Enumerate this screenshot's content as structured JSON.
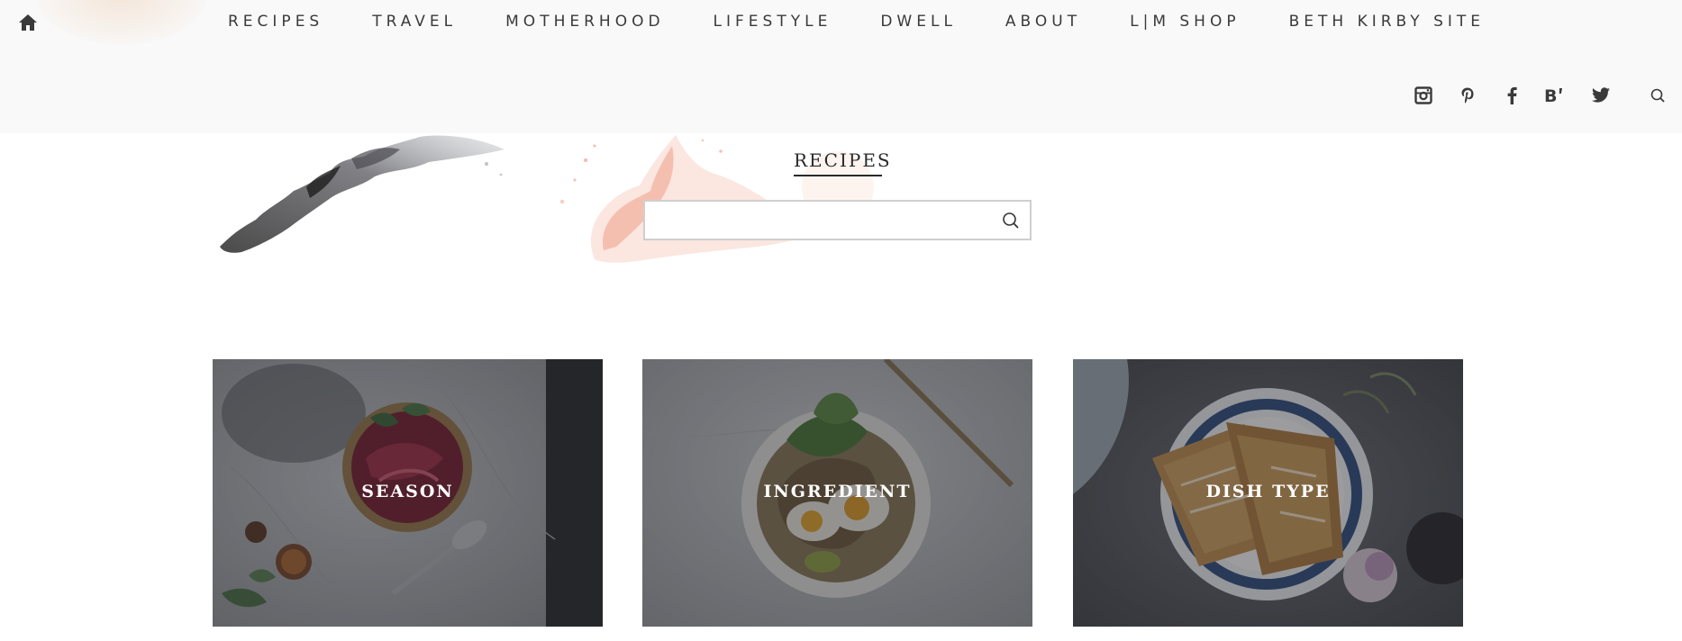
{
  "nav": {
    "home_icon": "home-icon",
    "items": [
      {
        "label": "RECIPES"
      },
      {
        "label": "TRAVEL"
      },
      {
        "label": "MOTHERHOOD"
      },
      {
        "label": "LIFESTYLE"
      },
      {
        "label": "DWELL"
      },
      {
        "label": "ABOUT"
      },
      {
        "label": "L|M SHOP"
      },
      {
        "label": "BETH KIRBY SITE"
      }
    ]
  },
  "social": {
    "icons": [
      "instagram-icon",
      "pinterest-icon",
      "facebook-icon",
      "bloglovin-icon",
      "twitter-icon",
      "search-icon"
    ]
  },
  "page": {
    "title": "RECIPES"
  },
  "search": {
    "value": "",
    "placeholder": ""
  },
  "cards": [
    {
      "label": "SEASON"
    },
    {
      "label": "INGREDIENT"
    },
    {
      "label": "DISH TYPE"
    }
  ],
  "colors": {
    "header_bg": "#f9f9f9",
    "text": "#3a3a3a",
    "overlay": "rgba(30,30,35,0.45)"
  }
}
